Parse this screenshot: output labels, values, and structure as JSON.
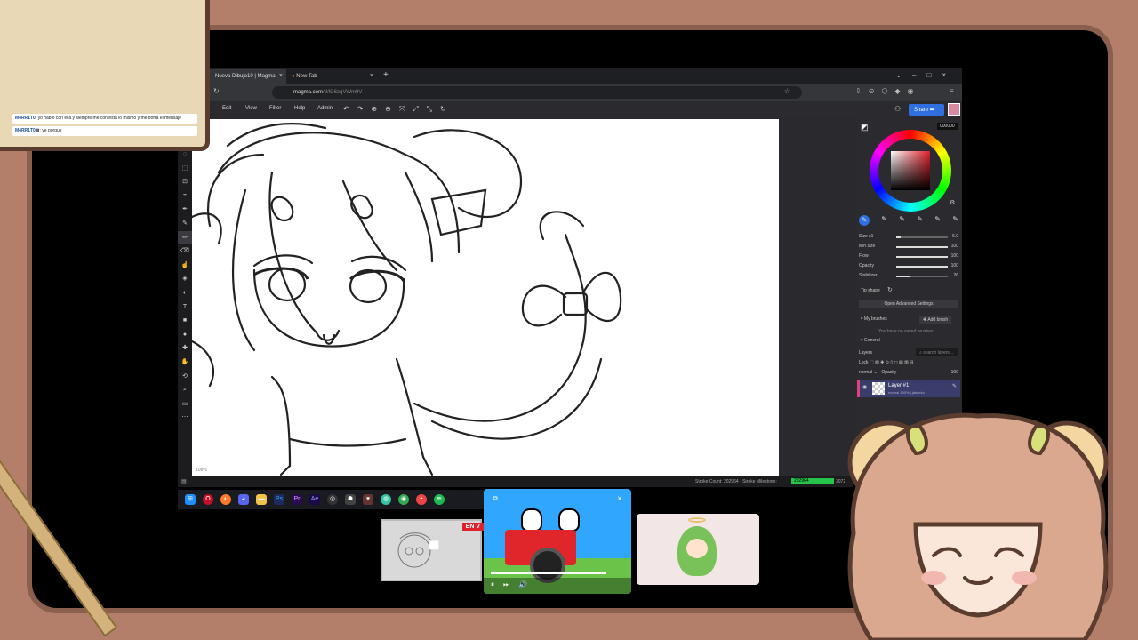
{
  "chat": {
    "messages": [
      {
        "user": "M4RR1T0",
        "text": ": yo hablo con ella y siempre me contesta lo mismo y me borra el mensaje"
      },
      {
        "user": "M4RR1T0",
        "text": ": ve porque"
      }
    ]
  },
  "browser": {
    "tabs": [
      {
        "label": "Nueva Dibujo10 | Magma"
      },
      {
        "label": "New Tab"
      }
    ],
    "url_host": "magma.com",
    "url_path": "/d/lG6zqVWm9V",
    "menu": [
      "Edit",
      "View",
      "Filter",
      "Help",
      "Admin"
    ],
    "share_label": "Share"
  },
  "canvas": {
    "zoom_label": "108%"
  },
  "panel": {
    "hex_value": "000000",
    "brush_settings": [
      {
        "label": "Size x1",
        "value": "6.0",
        "fill": 0.08
      },
      {
        "label": "Min size",
        "value": "100",
        "fill": 1.0
      },
      {
        "label": "Flow",
        "value": "100",
        "fill": 1.0
      },
      {
        "label": "Opacity",
        "value": "100",
        "fill": 1.0
      },
      {
        "label": "Stabilizer",
        "value": "26",
        "fill": 0.26
      }
    ],
    "tip_shape_label": "Tip shape",
    "advanced_label": "Open Advanced Settings",
    "my_brushes_label": "My brushes",
    "add_brush_label": "Add brush",
    "no_saved_label": "You have no saved brushes",
    "general_label": "General",
    "layers_label": "Layers",
    "search_layers_placeholder": "search layers...",
    "lock_label": "Lock",
    "blend_mode": "normal",
    "opacity_label": "Opacity",
    "opacity_value": "100",
    "layer_name": "Layer #1",
    "layer_sub": "normal 100% | jabneko"
  },
  "status": {
    "strokes_text": "Stroke Count: 202964 · Stroke Milestone:",
    "milestone_value": "202964",
    "right_value": "3072"
  },
  "preview": {
    "live_badge": "EN V"
  },
  "colors": {
    "background": "#b47f6a",
    "accent_blue": "#2f6fe0",
    "milestone_green": "#26c44a",
    "live_red": "#e0202a"
  }
}
